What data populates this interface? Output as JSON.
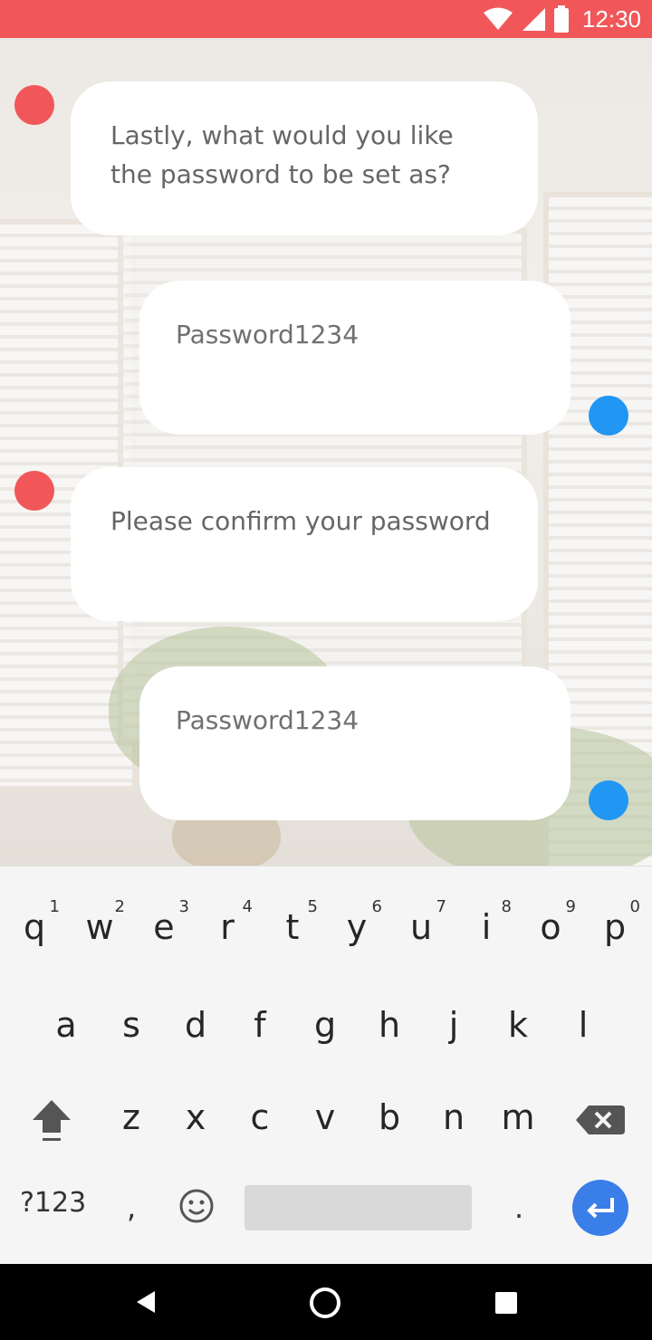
{
  "status_bar": {
    "time": "12:30",
    "background": "#f15759"
  },
  "conversation": [
    {
      "sender": "bot",
      "text": "Lastly, what would you like the password to be set as?"
    },
    {
      "sender": "user",
      "text": "Password1234"
    },
    {
      "sender": "bot",
      "text": "Please confirm your password"
    },
    {
      "sender": "user",
      "text": "Password1234"
    }
  ],
  "colors": {
    "bot_dot": "#f15759",
    "user_dot": "#2196f3",
    "enter_button": "#3a7ee8"
  },
  "keyboard": {
    "row1": [
      {
        "key": "q",
        "hint": "1"
      },
      {
        "key": "w",
        "hint": "2"
      },
      {
        "key": "e",
        "hint": "3"
      },
      {
        "key": "r",
        "hint": "4"
      },
      {
        "key": "t",
        "hint": "5"
      },
      {
        "key": "y",
        "hint": "6"
      },
      {
        "key": "u",
        "hint": "7"
      },
      {
        "key": "i",
        "hint": "8"
      },
      {
        "key": "o",
        "hint": "9"
      },
      {
        "key": "p",
        "hint": "0"
      }
    ],
    "row2": [
      "a",
      "s",
      "d",
      "f",
      "g",
      "h",
      "j",
      "k",
      "l"
    ],
    "row3": [
      "z",
      "x",
      "c",
      "v",
      "b",
      "n",
      "m"
    ],
    "symbols_label": "?123",
    "comma_label": ",",
    "period_label": ".",
    "icons": {
      "shift": "shift-icon",
      "backspace": "backspace-icon",
      "emoji": "emoji-icon",
      "enter": "enter-icon"
    }
  },
  "nav_bar": {
    "icons": [
      "back-icon",
      "home-icon",
      "recents-icon"
    ]
  }
}
